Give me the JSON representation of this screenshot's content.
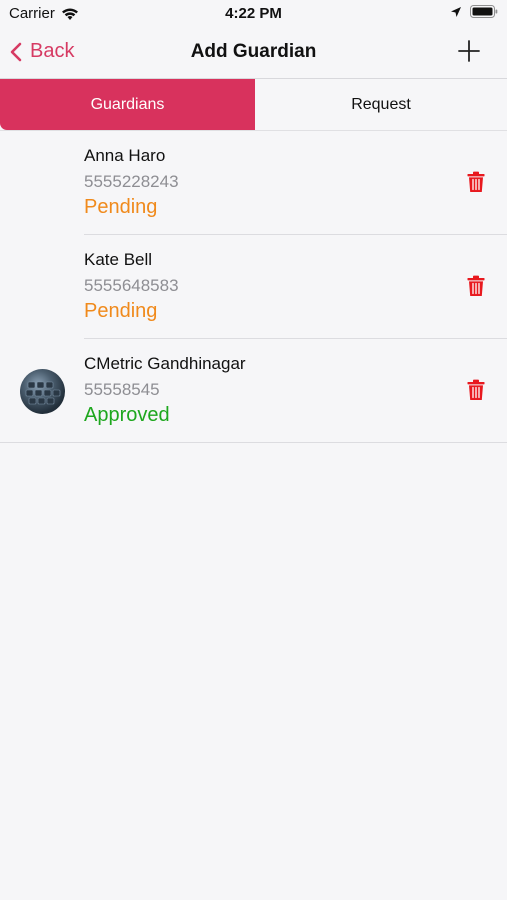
{
  "status_bar": {
    "carrier": "Carrier",
    "time": "4:22 PM"
  },
  "nav": {
    "back_label": "Back",
    "title": "Add Guardian"
  },
  "tabs": [
    {
      "label": "Guardians",
      "active": true
    },
    {
      "label": "Request",
      "active": false
    }
  ],
  "guardians": [
    {
      "name": "Anna Haro",
      "phone": "5555228243",
      "status": "Pending"
    },
    {
      "name": "Kate Bell",
      "phone": "5555648583",
      "status": "Pending"
    },
    {
      "name": "CMetric Gandhinagar",
      "phone": "55558545",
      "status": "Approved"
    }
  ],
  "colors": {
    "accent": "#d8325d",
    "pending": "#f08a1c",
    "approved": "#1ea71e",
    "delete": "#e8191f"
  }
}
